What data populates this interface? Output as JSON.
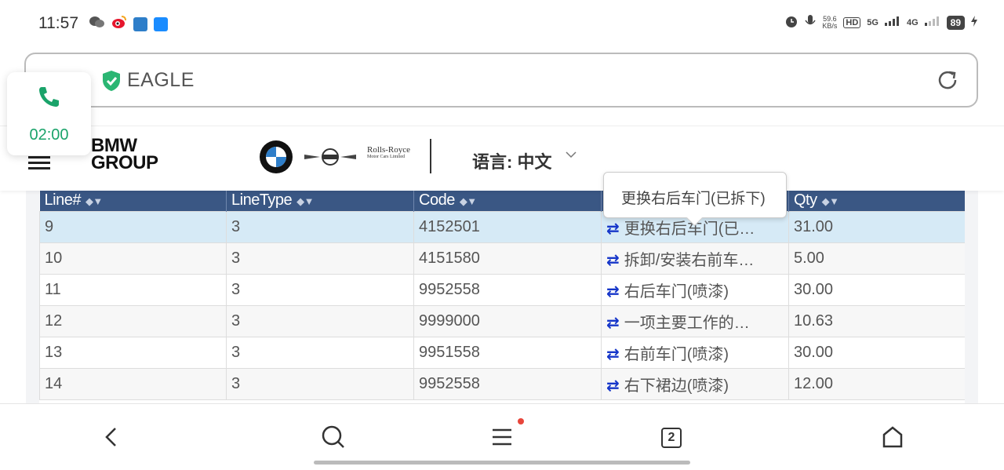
{
  "status_bar": {
    "time": "11:57",
    "net_speed": "59.6",
    "net_unit": "KB/s",
    "hd": "HD",
    "sig1": "5G",
    "sig2": "4G",
    "battery": "89"
  },
  "address_bar": {
    "site_name": "EAGLE"
  },
  "floating_call": {
    "timer": "02:00"
  },
  "header": {
    "brand_line1": "BMW",
    "brand_line2": "GROUP",
    "rr_line1": "Rolls-Royce",
    "rr_line2": "Motor Cars Limited",
    "language_label": "语言: 中文"
  },
  "table": {
    "columns": [
      "Line#",
      "LineType",
      "Code",
      "",
      "Qty"
    ],
    "rows": [
      {
        "line": "9",
        "type": "3",
        "code": "4152501",
        "desc": "更换右后车门(已…",
        "qty": "31.00"
      },
      {
        "line": "10",
        "type": "3",
        "code": "4151580",
        "desc": "拆卸/安装右前车…",
        "qty": "5.00"
      },
      {
        "line": "11",
        "type": "3",
        "code": "9952558",
        "desc": "右后车门(喷漆)",
        "qty": "30.00"
      },
      {
        "line": "12",
        "type": "3",
        "code": "9999000",
        "desc": "一项主要工作的…",
        "qty": "10.63"
      },
      {
        "line": "13",
        "type": "3",
        "code": "9951558",
        "desc": "右前车门(喷漆)",
        "qty": "30.00"
      },
      {
        "line": "14",
        "type": "3",
        "code": "9952558",
        "desc": "右下裙边(喷漆)",
        "qty": "12.00"
      }
    ]
  },
  "tooltip": {
    "text": "更换右后车门(已拆下)"
  },
  "bottom_nav": {
    "tab_count": "2"
  },
  "colors": {
    "header_bg": "#3a5784",
    "selected_row": "#d6eaf6",
    "call_green": "#1aa36a",
    "exchange_icon": "#1636c9"
  }
}
